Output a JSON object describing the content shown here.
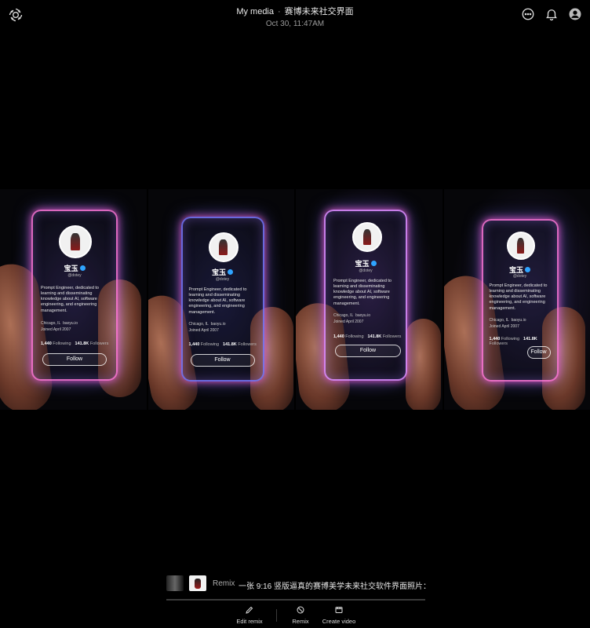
{
  "header": {
    "app_icon": "openai-logo-icon",
    "title": "My media",
    "separator": "·",
    "subtitle": "赛博未来社交界面",
    "date": "Oct 30, 11:47AM",
    "icons": [
      "more-icon",
      "bell-icon",
      "profile-icon"
    ]
  },
  "gallery": {
    "cards": [
      {
        "name": "宝玉",
        "handle": "@dotey",
        "bio": "Prompt Engineer, dedicated to learning and disseminating knowledge about AI, software engineering, and engineering management.",
        "location": "Chicago, IL",
        "link": "baoyu.io",
        "joined": "Joined April 2007",
        "following": "1,440",
        "following_label": "Following",
        "followers": "141.8K",
        "followers_label": "Followers",
        "follow_label": "Follow"
      },
      {
        "name": "宝玉",
        "handle": "@dotey",
        "bio": "Prompt Engineer, dedicated to learning and disseminating knowledge about AI, software engineering, and engineering management.",
        "location": "Chicago, IL",
        "link": "baoyu.io",
        "joined": "Joined April 2007",
        "following": "1,440",
        "following_label": "Following",
        "followers": "141.8K",
        "followers_label": "Followers",
        "follow_label": "Follow"
      },
      {
        "name": "宝玉",
        "handle": "@dotey",
        "bio": "Prompt Engineer, dedicated to learning and disseminating knowledge about AI, software engineering, and engineering management.",
        "location": "Chicago, IL",
        "link": "baoyu.io",
        "joined": "Joined April 2007",
        "following": "1,440",
        "following_label": "Following",
        "followers": "141.8K",
        "followers_label": "Followers",
        "follow_label": "Follow"
      },
      {
        "name": "宝玉",
        "handle": "@dotey",
        "bio": "Prompt Engineer, dedicated to learning and disseminating knowledge about AI, software engineering, and engineering management.",
        "location": "Chicago, IL",
        "link": "baoyu.io",
        "joined": "Joined April 2007",
        "following": "1,440",
        "following_label": "Following",
        "followers": "141.8K",
        "followers_label": "Followers",
        "follow_label": "Follow"
      }
    ]
  },
  "remix_bar": {
    "label": "Remix",
    "prompt": "一张 9:16 竖版逼真的赛博美学未来社交软件界面照片：一...",
    "progress": 0.0
  },
  "actions": {
    "edit_remix": "Edit remix",
    "remix": "Remix",
    "create_video": "Create video"
  }
}
